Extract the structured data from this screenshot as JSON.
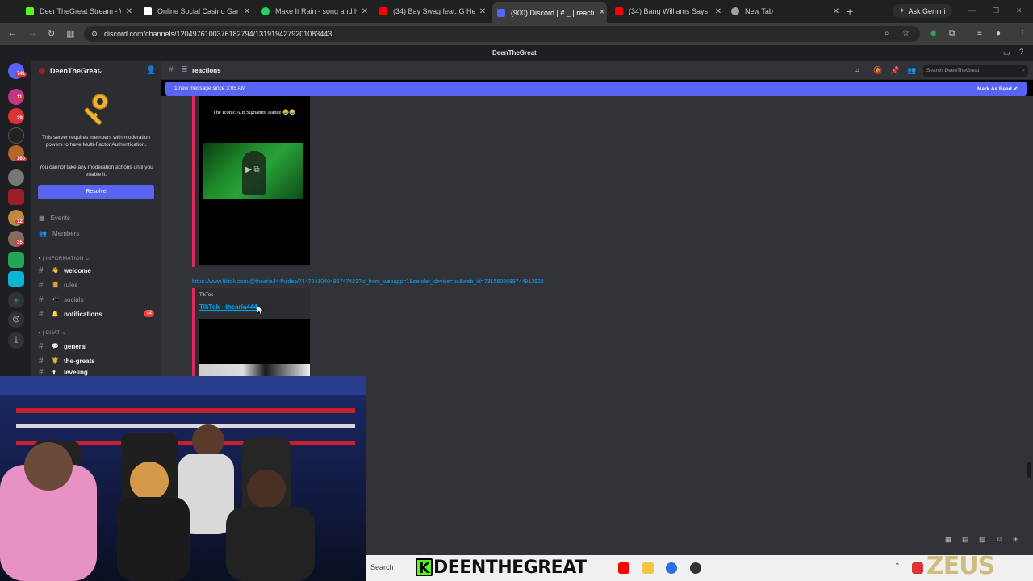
{
  "browser": {
    "tabs": [
      {
        "label": "DeenTheGreat Stream - Wa",
        "favicon_color": "#53fc18",
        "active": false
      },
      {
        "label": "Online Social Casino Game",
        "favicon_color": "#ffffff",
        "active": false
      },
      {
        "label": "Make It Rain - song and ly",
        "favicon_color": "#1ed760",
        "active": false
      },
      {
        "label": "(34) Bay Swag feat. G Herb",
        "favicon_color": "#ff0000",
        "active": false
      },
      {
        "label": "(900) Discord | # _ | reacti",
        "favicon_color": "#5865f2",
        "active": true
      },
      {
        "label": "(34) Bang Williams Says He",
        "favicon_color": "#ff0000",
        "active": false
      },
      {
        "label": "New Tab",
        "favicon_color": "#9aa0a6",
        "active": false
      }
    ],
    "new_tab_symbol": "+",
    "gemini_label": "Ask Gemini",
    "url": "discord.com/channels/1204976100376182794/1319194279201083443"
  },
  "discord": {
    "window_title": "DeenTheGreat",
    "guild_badges": [
      "741",
      "11",
      "29",
      "160",
      "12",
      "35"
    ],
    "server": {
      "name": "DeenTheGreat",
      "mfa_notice": "This server requires members with moderation powers to have Multi-Factor Authentication.",
      "mfa_sub": "You cannot take any moderation actions until you enable it.",
      "resolve_label": "Resolve",
      "events_label": "Events",
      "members_label": "Members"
    },
    "categories": {
      "information": "| INFORMATION ⌄",
      "chat": "| CHAT ⌄"
    },
    "channels": [
      {
        "name": "welcome",
        "emoji": "👋",
        "bright": true
      },
      {
        "name": "rules",
        "emoji": "📙",
        "bright": false
      },
      {
        "name": "socials",
        "emoji": "📲",
        "bright": false
      },
      {
        "name": "notifications",
        "emoji": "🔔",
        "bright": true,
        "badge": "12"
      },
      {
        "name": "general",
        "emoji": "💬",
        "bright": true
      },
      {
        "name": "the-greats",
        "emoji": "🤴",
        "bright": true
      },
      {
        "name": "leveling",
        "emoji": "⬆",
        "bright": true
      }
    ],
    "channel_header": {
      "name": "reactions",
      "search_placeholder": "Search DeenTheGreat"
    },
    "new_message_bar": {
      "text": "1 new message since 3:05 AM",
      "action": "Mark As Read"
    },
    "messages": {
      "embed1_title": "The Iconic A.B Signature Dance 😂😂",
      "tiktok_url": "https://www.tiktok.com/@thearia444/video/7447241040486747423?is_from_webapp=1&sender_device=pc&web_id=7315802689744913922",
      "embed2_provider": "TikTok",
      "embed2_title": "TikTok · thearia444"
    }
  },
  "taskbar": {
    "search_label": "Search",
    "overlay_brand_k": "K",
    "overlay_brand": "DEENTHEGREAT",
    "watermark": "ZEUS"
  }
}
